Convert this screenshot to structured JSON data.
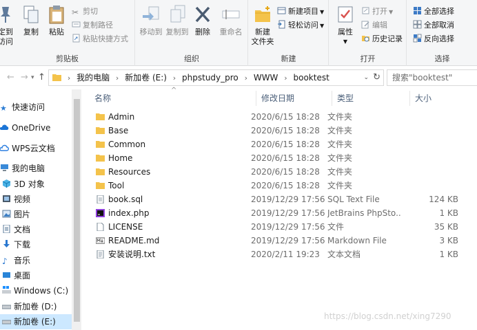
{
  "ribbon": {
    "clipboard": {
      "pin_label": "定到\n访问",
      "copy_label": "复制",
      "paste_label": "粘贴",
      "cut_label": "剪切",
      "copy_path_label": "复制路径",
      "paste_shortcut_label": "粘贴快捷方式",
      "group_label": "剪贴板"
    },
    "organize": {
      "move_to_label": "移动到",
      "copy_to_label": "复制到",
      "delete_label": "删除",
      "rename_label": "重命名",
      "group_label": "组织"
    },
    "new": {
      "new_folder_label": "新建\n文件夹",
      "new_item_label": "新建项目",
      "easy_access_label": "轻松访问",
      "group_label": "新建"
    },
    "open": {
      "properties_label": "属性",
      "open_label": "打开",
      "edit_label": "编辑",
      "history_label": "历史记录",
      "group_label": "打开"
    },
    "select": {
      "select_all_label": "全部选择",
      "select_none_label": "全部取消",
      "invert_label": "反向选择",
      "group_label": "选择"
    }
  },
  "address": {
    "segments": [
      "我的电脑",
      "新加卷 (E:)",
      "phpstudy_pro",
      "WWW",
      "booktest"
    ],
    "search_placeholder": "搜索\"booktest\""
  },
  "sidebar": {
    "items": [
      {
        "label": "快速访问",
        "icon": "star-icon"
      },
      {
        "label": "OneDrive",
        "icon": "cloud-icon"
      },
      {
        "label": "WPS云文档",
        "icon": "wps-cloud-icon"
      },
      {
        "label": "我的电脑",
        "icon": "computer-icon"
      },
      {
        "label": "3D 对象",
        "icon": "cube-icon"
      },
      {
        "label": "视频",
        "icon": "video-icon"
      },
      {
        "label": "图片",
        "icon": "picture-icon"
      },
      {
        "label": "文档",
        "icon": "document-icon"
      },
      {
        "label": "下载",
        "icon": "download-icon"
      },
      {
        "label": "音乐",
        "icon": "music-icon"
      },
      {
        "label": "桌面",
        "icon": "desktop-icon"
      },
      {
        "label": "Windows (C:)",
        "icon": "windows-drive-icon"
      },
      {
        "label": "新加卷 (D:)",
        "icon": "drive-icon"
      },
      {
        "label": "新加卷 (E:)",
        "icon": "drive-icon"
      }
    ],
    "selected": "新加卷 (E:)"
  },
  "columns": {
    "name": "名称",
    "date": "修改日期",
    "type": "类型",
    "size": "大小"
  },
  "files": [
    {
      "name": "Admin",
      "date": "2020/6/15 18:28",
      "type": "文件夹",
      "size": "",
      "icon": "folder-icon"
    },
    {
      "name": "Base",
      "date": "2020/6/15 18:28",
      "type": "文件夹",
      "size": "",
      "icon": "folder-icon"
    },
    {
      "name": "Common",
      "date": "2020/6/15 18:28",
      "type": "文件夹",
      "size": "",
      "icon": "folder-icon"
    },
    {
      "name": "Home",
      "date": "2020/6/15 18:28",
      "type": "文件夹",
      "size": "",
      "icon": "folder-icon"
    },
    {
      "name": "Resources",
      "date": "2020/6/15 18:28",
      "type": "文件夹",
      "size": "",
      "icon": "folder-icon"
    },
    {
      "name": "Tool",
      "date": "2020/6/15 18:28",
      "type": "文件夹",
      "size": "",
      "icon": "folder-icon"
    },
    {
      "name": "book.sql",
      "date": "2019/12/29 17:56",
      "type": "SQL Text File",
      "size": "124 KB",
      "icon": "sql-file-icon"
    },
    {
      "name": "index.php",
      "date": "2019/12/29 17:56",
      "type": "JetBrains PhpSto...",
      "size": "1 KB",
      "icon": "phpstorm-file-icon"
    },
    {
      "name": "LICENSE",
      "date": "2019/12/29 17:56",
      "type": "文件",
      "size": "35 KB",
      "icon": "file-icon"
    },
    {
      "name": "README.md",
      "date": "2019/12/29 17:56",
      "type": "Markdown File",
      "size": "3 KB",
      "icon": "markdown-file-icon"
    },
    {
      "name": "安装说明.txt",
      "date": "2020/2/11 19:23",
      "type": "文本文档",
      "size": "1 KB",
      "icon": "text-file-icon"
    }
  ],
  "watermark": "https://blog.csdn.net/xing7290",
  "colors": {
    "selection": "#cce8ff",
    "folder": "#f4c34b",
    "accent": "#0078d7"
  }
}
